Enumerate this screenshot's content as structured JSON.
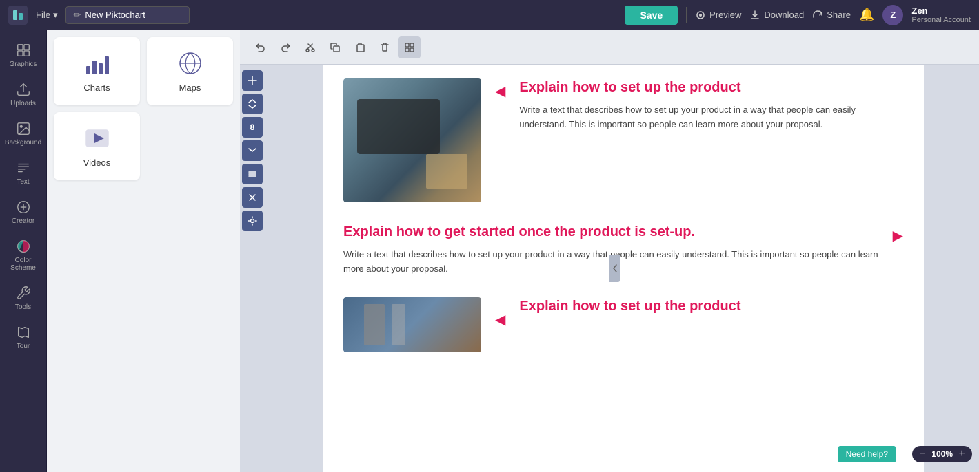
{
  "topbar": {
    "logo_text": "P",
    "file_label": "File",
    "file_chevron": "▾",
    "title_icon": "✏",
    "title_value": "New Piktochart",
    "save_label": "Save",
    "divider": true,
    "preview_label": "Preview",
    "download_label": "Download",
    "share_label": "Share",
    "user_name": "Zen",
    "user_account": "Personal Account"
  },
  "sidebar": {
    "items": [
      {
        "id": "graphics",
        "label": "Graphics",
        "icon": "graphics"
      },
      {
        "id": "uploads",
        "label": "Uploads",
        "icon": "uploads"
      },
      {
        "id": "background",
        "label": "Background",
        "icon": "background"
      },
      {
        "id": "text",
        "label": "Text",
        "icon": "text"
      },
      {
        "id": "creator",
        "label": "Creator",
        "icon": "creator"
      },
      {
        "id": "color-scheme",
        "label": "Color Scheme",
        "icon": "colorscheme"
      },
      {
        "id": "tools",
        "label": "Tools",
        "icon": "tools"
      },
      {
        "id": "tour",
        "label": "Tour",
        "icon": "tour"
      }
    ]
  },
  "panel": {
    "cards": [
      {
        "id": "charts",
        "label": "Charts",
        "icon": "charts"
      },
      {
        "id": "maps",
        "label": "Maps",
        "icon": "maps"
      },
      {
        "id": "videos",
        "label": "Videos",
        "icon": "videos"
      }
    ]
  },
  "canvas_toolbar": {
    "buttons": [
      {
        "id": "undo",
        "label": "Undo",
        "icon": "undo"
      },
      {
        "id": "redo",
        "label": "Redo",
        "icon": "redo"
      },
      {
        "id": "cut",
        "label": "Cut",
        "icon": "cut"
      },
      {
        "id": "copy",
        "label": "Copy",
        "icon": "copy"
      },
      {
        "id": "paste",
        "label": "Paste",
        "icon": "paste"
      },
      {
        "id": "delete",
        "label": "Delete",
        "icon": "delete"
      },
      {
        "id": "grid",
        "label": "Grid",
        "icon": "grid",
        "active": true
      }
    ]
  },
  "vertical_strip": {
    "buttons": [
      {
        "id": "add",
        "icon": "plus",
        "label": "Add"
      },
      {
        "id": "expand",
        "icon": "expand",
        "label": "Expand"
      },
      {
        "id": "counter",
        "value": "8",
        "label": "Page count"
      },
      {
        "id": "collapse",
        "icon": "collapse",
        "label": "Collapse"
      },
      {
        "id": "list",
        "icon": "list",
        "label": "List"
      },
      {
        "id": "close",
        "icon": "close",
        "label": "Close"
      },
      {
        "id": "settings",
        "icon": "settings",
        "label": "Settings"
      }
    ]
  },
  "content": {
    "sections": [
      {
        "id": "section-1",
        "arrow_direction": "left",
        "heading": "Explain how to set up the product",
        "body": "Write a text that describes how to set up your product in a way that people can easily understand. This is important so people can learn more about  your proposal.",
        "has_image": true,
        "image_position": "left"
      },
      {
        "id": "section-2",
        "arrow_direction": "right",
        "heading": "Explain how to get started once the product is set-up.",
        "body": "Write a text that describes how to set up your product in a way that people can easily understand. This is important so people can learn more about  your proposal.",
        "has_image": false,
        "image_position": "right"
      },
      {
        "id": "section-3",
        "arrow_direction": "left",
        "heading": "Explain how to set up the product",
        "body": "",
        "has_image": true,
        "image_position": "left"
      }
    ]
  },
  "zoom": {
    "level": "100%",
    "minus_label": "−",
    "plus_label": "+"
  },
  "collapse_handle_icon": "◀",
  "need_help_label": "Need help?"
}
